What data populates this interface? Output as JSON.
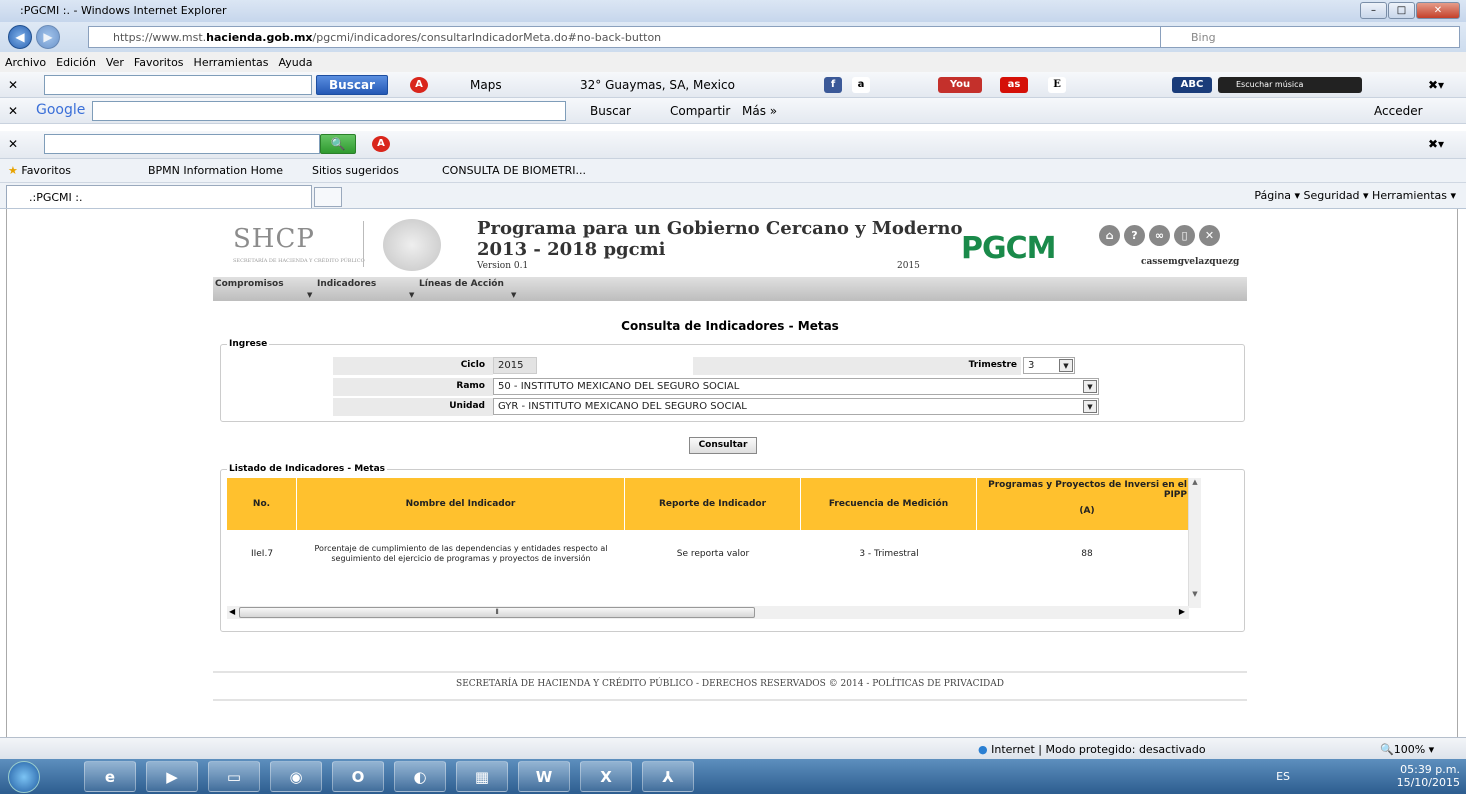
{
  "window": {
    "title": ":PGCMI :. - Windows Internet Explorer"
  },
  "address": {
    "url_prefix": "https://www.mst.",
    "url_domain": "hacienda.gob.mx",
    "url_path": "/pgcmi/indicadores/consultarIndicadorMeta.do#no-back-button",
    "search_engine": "Bing"
  },
  "menubar": [
    "Archivo",
    "Edición",
    "Ver",
    "Favoritos",
    "Herramientas",
    "Ayuda"
  ],
  "ask_toolbar": {
    "search_button": "Buscar",
    "maps": "Maps",
    "weather": "32° Guaymas, SA, Mexico",
    "abc": "ABC",
    "music": "Escuchar música"
  },
  "google_toolbar": {
    "brand": "Google",
    "search": "Buscar",
    "share": "Compartir",
    "more": "Más »",
    "login": "Acceder"
  },
  "favorites_bar": {
    "favorites": "Favoritos",
    "items": [
      "BPMN Information Home",
      "Sitios sugeridos",
      "CONSULTA DE BIOMETRI..."
    ]
  },
  "tab": {
    "label": ".:PGCMI :."
  },
  "commandbar": "Página ▾   Seguridad ▾   Herramientas ▾",
  "page": {
    "header": {
      "shcp": "SHCP",
      "shcp_sub": "SECRETARÍA DE HACIENDA Y CRÉDITO PÚBLICO",
      "title_line1": "Programa para un Gobierno Cercano y Moderno",
      "title_line2": "2013 - 2018 pgcmi",
      "version": "Version 0.1",
      "year": "2015",
      "logo": "PGCM",
      "user": "cassemgvelazquezg"
    },
    "menu": [
      "Compromisos",
      "Indicadores",
      "Líneas de Acción"
    ],
    "section_title": "Consulta de Indicadores - Metas",
    "form": {
      "legend": "Ingrese",
      "ciclo_label": "Ciclo",
      "ciclo_value": "2015",
      "trimestre_label": "Trimestre",
      "trimestre_value": "3",
      "ramo_label": "Ramo",
      "ramo_value": "50 - INSTITUTO MEXICANO DEL SEGURO SOCIAL",
      "unidad_label": "Unidad",
      "unidad_value": "GYR - INSTITUTO MEXICANO DEL SEGURO SOCIAL"
    },
    "consultar": "Consultar",
    "list": {
      "legend": "Listado de Indicadores - Metas",
      "headers": [
        "No.",
        "Nombre del Indicador",
        "Reporte de Indicador",
        "Frecuencia de Medición",
        "Programas y Proyectos de Inversi en el PIPP",
        "(A)"
      ],
      "rows": [
        {
          "no": "IIeI.7",
          "nombre": "Porcentaje de cumplimiento de las dependencias y entidades respecto al seguimiento del ejercicio de programas y proyectos de inversión",
          "reporte": "Se reporta valor",
          "frecuencia": "3 - Trimestral",
          "valor": "88"
        }
      ]
    },
    "footer": "SECRETARÍA DE HACIENDA Y CRÉDITO PÚBLICO - DERECHOS RESERVADOS © 2014 - POLÍTICAS DE PRIVACIDAD"
  },
  "status": {
    "zone": "Internet | Modo protegido: desactivado",
    "zoom": "100%"
  },
  "tray": {
    "lang": "ES",
    "time": "05:39 p.m.",
    "date": "15/10/2015"
  }
}
